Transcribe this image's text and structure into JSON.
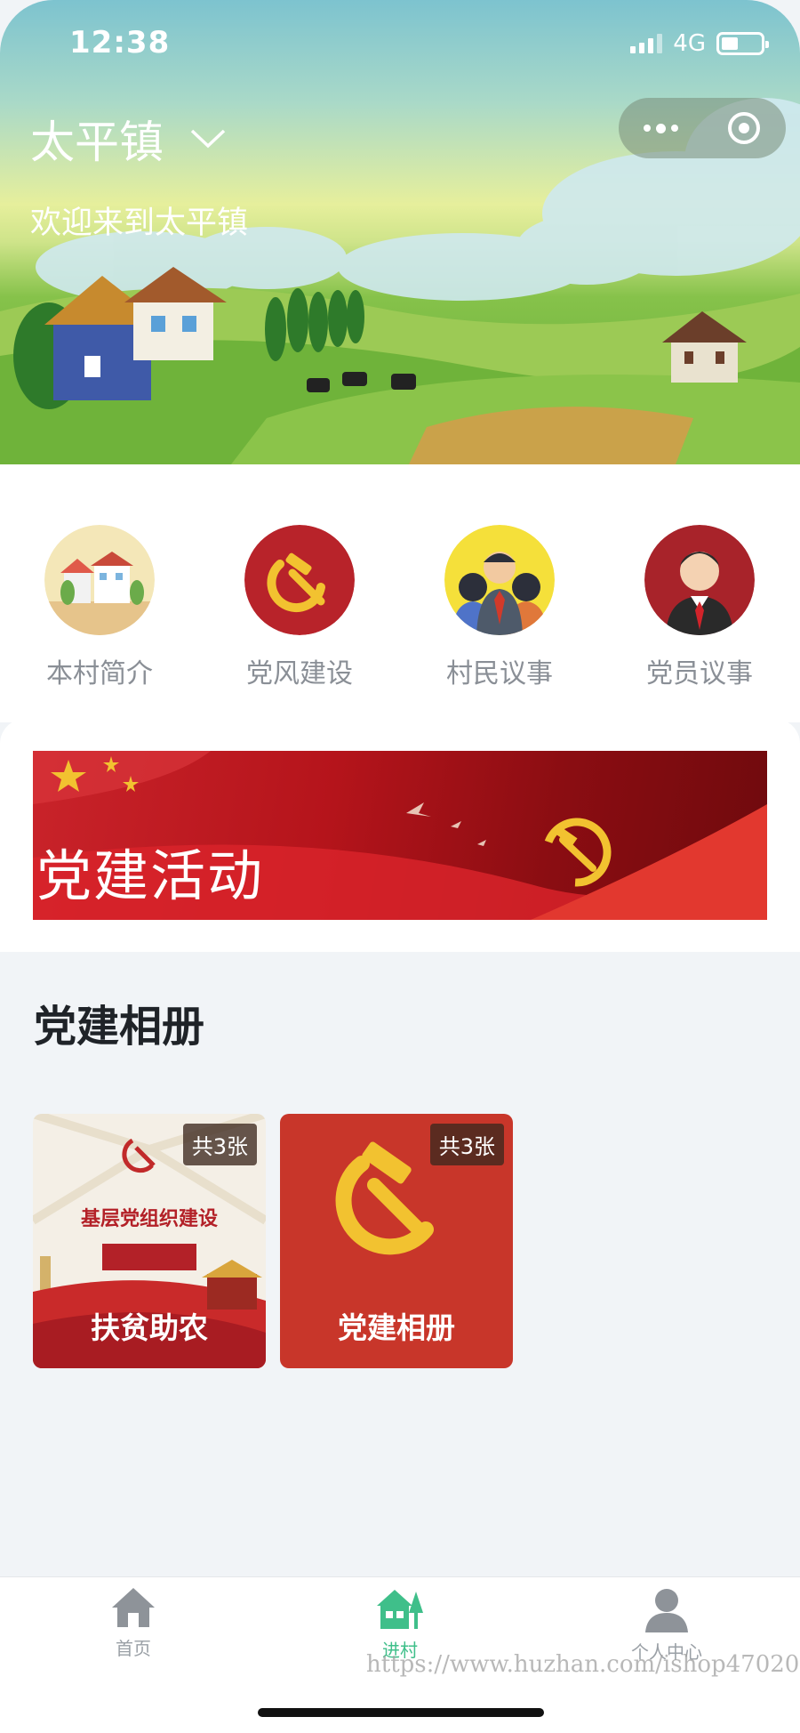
{
  "status": {
    "time": "12:38",
    "network": "4G"
  },
  "header": {
    "town": "太平镇",
    "welcome": "欢迎来到太平镇"
  },
  "quick_nav": [
    {
      "label": "本村简介",
      "icon": "village-icon"
    },
    {
      "label": "党风建设",
      "icon": "party-emblem-icon"
    },
    {
      "label": "村民议事",
      "icon": "villagers-icon"
    },
    {
      "label": "党员议事",
      "icon": "party-member-icon"
    }
  ],
  "banner": {
    "title": "党建活动"
  },
  "album": {
    "title": "党建相册",
    "cards": [
      {
        "name": "扶贫助农",
        "count": "共3张",
        "poster_text": "基层党组织建设"
      },
      {
        "name": "党建相册",
        "count": "共3张"
      }
    ]
  },
  "tabbar": {
    "items": [
      {
        "label": "首页",
        "icon": "home-icon",
        "active": false
      },
      {
        "label": "进村",
        "icon": "village-tab-icon",
        "active": true
      },
      {
        "label": "个人中心",
        "icon": "user-icon",
        "active": false
      }
    ]
  },
  "watermark": "https://www.huzhan.com/ishop47020",
  "colors": {
    "accent": "#3fbf8a",
    "party_red": "#c9232a",
    "gold": "#f2c230"
  }
}
